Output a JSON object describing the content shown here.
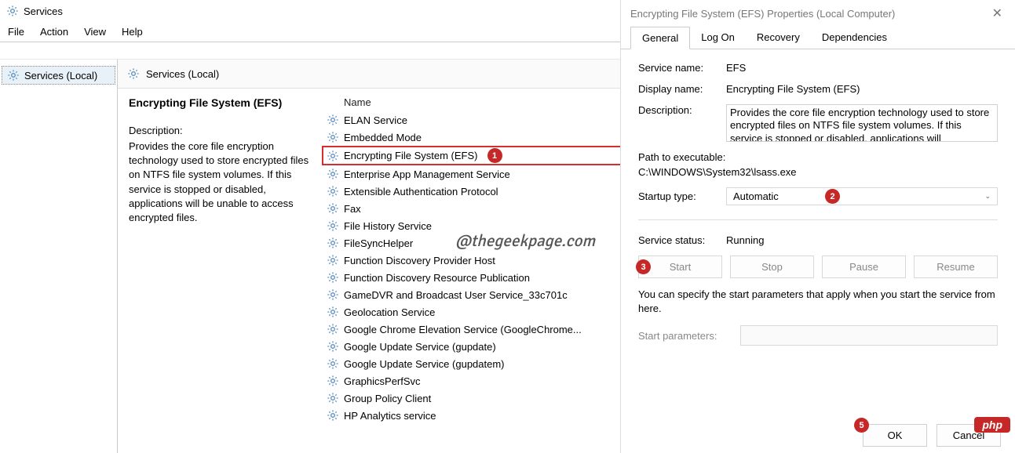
{
  "main_window": {
    "title": "Services",
    "menu": {
      "file": "File",
      "action": "Action",
      "view": "View",
      "help": "Help"
    },
    "tree_label": "Services (Local)"
  },
  "content": {
    "header_label": "Services (Local)",
    "detail": {
      "title": "Encrypting File System (EFS)",
      "desc_label": "Description:",
      "desc": "Provides the core file encryption technology used to store encrypted files on NTFS file system volumes. If this service is stopped or disabled, applications will be unable to access encrypted files."
    },
    "column_header": "Name",
    "services": [
      "ELAN Service",
      "Embedded Mode",
      "Encrypting File System (EFS)",
      "Enterprise App Management Service",
      "Extensible Authentication Protocol",
      "Fax",
      "File History Service",
      "FileSyncHelper",
      "Function Discovery Provider Host",
      "Function Discovery Resource Publication",
      "GameDVR and Broadcast User Service_33c701c",
      "Geolocation Service",
      "Google Chrome Elevation Service (GoogleChrome...",
      "Google Update Service (gupdate)",
      "Google Update Service (gupdatem)",
      "GraphicsPerfSvc",
      "Group Policy Client",
      "HP Analytics service"
    ],
    "selected_index": 2
  },
  "dialog": {
    "title": "Encrypting File System (EFS) Properties (Local Computer)",
    "tabs": {
      "general": "General",
      "logon": "Log On",
      "recovery": "Recovery",
      "deps": "Dependencies"
    },
    "labels": {
      "service_name": "Service name:",
      "display_name": "Display name:",
      "description": "Description:",
      "path": "Path to executable:",
      "startup": "Startup type:",
      "status": "Service status:",
      "params_hint": "You can specify the start parameters that apply when you start the service from here.",
      "start_params": "Start parameters:"
    },
    "values": {
      "service_name": "EFS",
      "display_name": "Encrypting File System (EFS)",
      "description": "Provides the core file encryption technology used to store encrypted files on NTFS file system volumes. If this service is stopped or disabled, applications will",
      "path": "C:\\WINDOWS\\System32\\lsass.exe",
      "startup": "Automatic",
      "status": "Running"
    },
    "buttons": {
      "start": "Start",
      "stop": "Stop",
      "pause": "Pause",
      "resume": "Resume",
      "ok": "OK",
      "cancel": "Cancel"
    }
  },
  "annotations": {
    "a1": "1",
    "a2": "2",
    "a3": "3",
    "a5": "5"
  },
  "watermark": "@thegeekpage.com",
  "php_badge": "php"
}
